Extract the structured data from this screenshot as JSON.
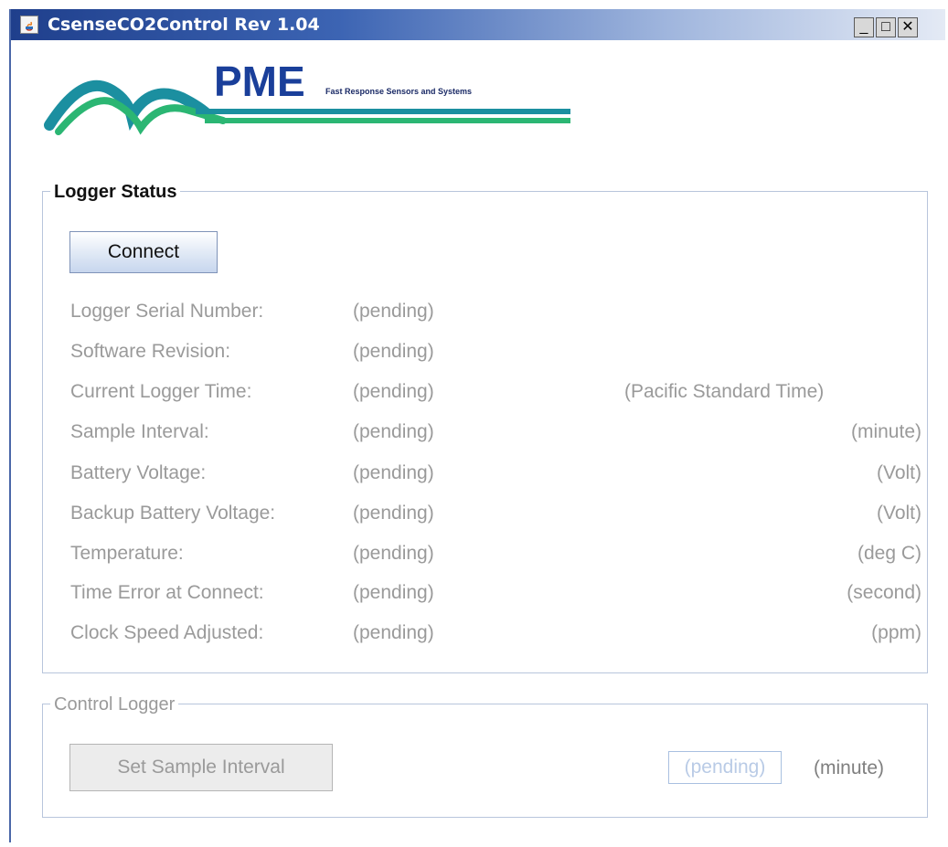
{
  "window": {
    "title": "CsenseCO2Control Rev 1.04",
    "controls": {
      "minimize": "_",
      "maximize": "□",
      "close": "✕"
    }
  },
  "logo": {
    "brand": "PME",
    "tagline": "Fast Response Sensors and Systems",
    "colors": {
      "blue": "#1a3f9a",
      "green": "#2bb673",
      "teal": "#1b8fa0"
    }
  },
  "logger_status": {
    "title": "Logger Status",
    "connect_label": "Connect",
    "rows": [
      {
        "label": "Logger Serial Number:",
        "value": "(pending)",
        "unit": ""
      },
      {
        "label": "Software Revision:",
        "value": "(pending)",
        "unit": ""
      },
      {
        "label": "Current Logger Time:",
        "value": "(pending)",
        "unit": "(Pacific Standard Time)"
      },
      {
        "label": "Sample Interval:",
        "value": "(pending)",
        "unit": "(minute)"
      },
      {
        "label": "Battery Voltage:",
        "value": "(pending)",
        "unit": "(Volt)"
      },
      {
        "label": "Backup Battery Voltage:",
        "value": "(pending)",
        "unit": "(Volt)"
      },
      {
        "label": "Temperature:",
        "value": "(pending)",
        "unit": "(deg C)"
      },
      {
        "label": "Time Error at Connect:",
        "value": "(pending)",
        "unit": "(second)"
      },
      {
        "label": "Clock Speed Adjusted:",
        "value": "(pending)",
        "unit": "(ppm)"
      }
    ]
  },
  "control_logger": {
    "title": "Control Logger",
    "set_interval_label": "Set Sample Interval",
    "interval_value": "(pending)",
    "interval_unit": "(minute)"
  }
}
